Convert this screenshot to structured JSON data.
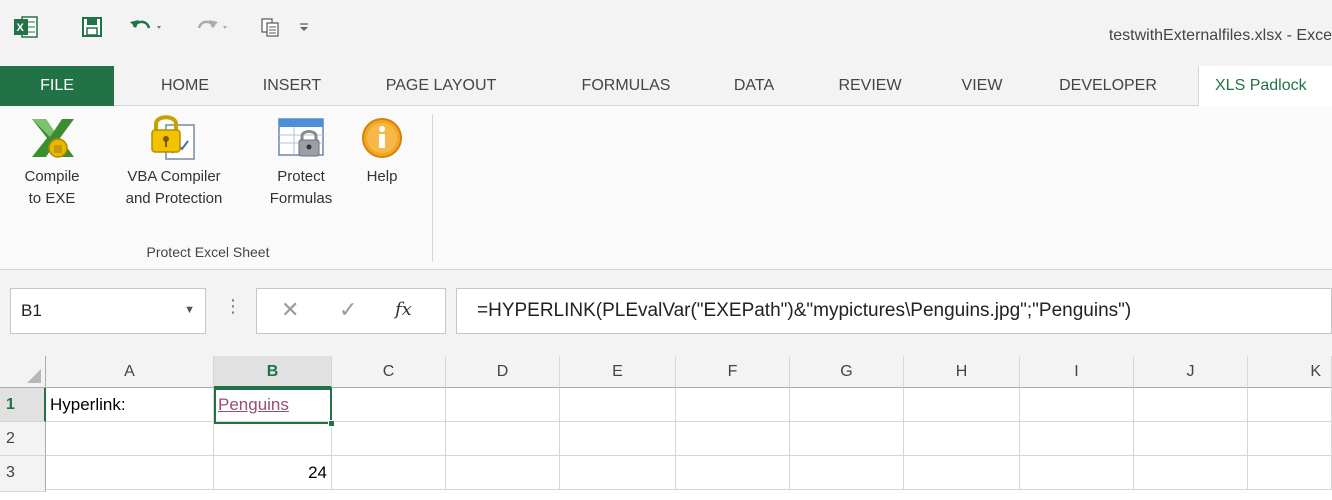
{
  "window": {
    "title": "testwithExternalfiles.xlsx - Exce"
  },
  "qat": {
    "excel_icon": "excel-logo-icon",
    "save_icon": "save-icon",
    "undo_icon": "undo-icon",
    "redo_icon": "redo-icon",
    "touch_icon": "touch-mode-icon",
    "customize_icon": "customize-qat-icon"
  },
  "tabs": [
    {
      "label": "FILE"
    },
    {
      "label": "HOME"
    },
    {
      "label": "INSERT"
    },
    {
      "label": "PAGE LAYOUT"
    },
    {
      "label": "FORMULAS"
    },
    {
      "label": "DATA"
    },
    {
      "label": "REVIEW"
    },
    {
      "label": "VIEW"
    },
    {
      "label": "DEVELOPER"
    },
    {
      "label": "XLS Padlock"
    }
  ],
  "ribbon": {
    "buttons": [
      {
        "line1": "Compile",
        "line2": "to EXE"
      },
      {
        "line1": "VBA Compiler",
        "line2": "and Protection"
      },
      {
        "line1": "Protect",
        "line2": "Formulas"
      },
      {
        "line1": "Help",
        "line2": ""
      }
    ],
    "group_label": "Protect Excel Sheet"
  },
  "formula_bar": {
    "name_box": "B1",
    "cancel": "✕",
    "enter": "✓",
    "fx": "fx",
    "separator": "⋮",
    "formula": "=HYPERLINK(PLEvalVar(\"EXEPath\")&\"mypictures\\Penguins.jpg\";\"Penguins\")"
  },
  "grid": {
    "columns": [
      "A",
      "B",
      "C",
      "D",
      "E",
      "F",
      "G",
      "H",
      "I",
      "J",
      "K"
    ],
    "rows": [
      "1",
      "2",
      "3"
    ],
    "cells": {
      "A1": "Hyperlink:",
      "B1": "Penguins",
      "B3": "24"
    }
  },
  "colors": {
    "accent": "#217346",
    "hyperlink": "#954f72"
  }
}
